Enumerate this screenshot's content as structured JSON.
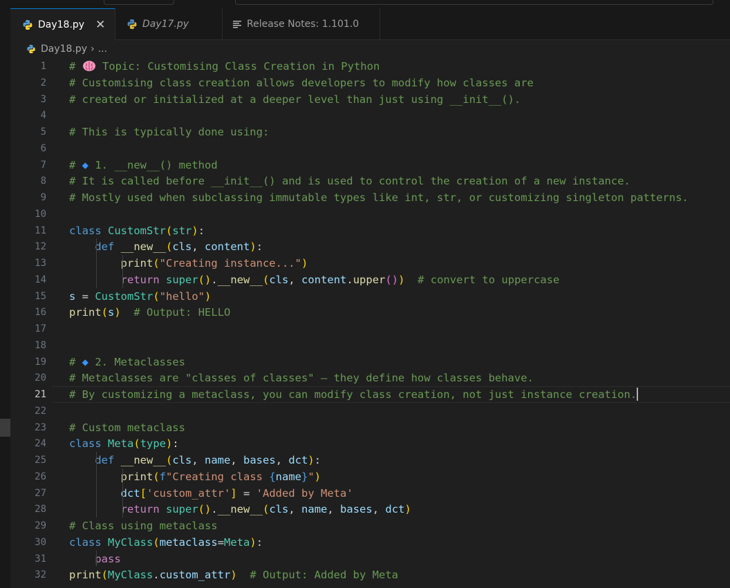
{
  "tabs": [
    {
      "label": "Day18.py",
      "active": true,
      "icon": "python-icon",
      "close": "✕"
    },
    {
      "label": "Day17.py",
      "active": false,
      "icon": "python-icon"
    },
    {
      "label": "Release Notes: 1.101.0",
      "active": false,
      "icon": "lines-icon"
    }
  ],
  "breadcrumb": {
    "file": "Day18.py",
    "separator": "›",
    "more": "..."
  },
  "editor": {
    "current_line": 21,
    "lines": [
      [
        [
          "c",
          "# "
        ],
        [
          "icon",
          "brain-emoji-icon"
        ],
        [
          "c",
          " Topic: Customising Class Creation in Python"
        ]
      ],
      [
        [
          "c",
          "# Customising class creation allows developers to modify how classes are"
        ]
      ],
      [
        [
          "c",
          "# created or initialized at a deeper level than just using __init__()."
        ]
      ],
      [],
      [
        [
          "c",
          "# This is typically done using:"
        ]
      ],
      [],
      [
        [
          "c",
          "# "
        ],
        [
          "dia",
          "◆"
        ],
        [
          "c",
          " 1. __new__() method"
        ]
      ],
      [
        [
          "c",
          "# It is called before __init__() and is used to control the creation of a new instance."
        ]
      ],
      [
        [
          "c",
          "# Mostly used when subclassing immutable types like int, str, or customizing singleton patterns."
        ]
      ],
      [],
      [
        [
          "k",
          "class"
        ],
        [
          "p",
          " "
        ],
        [
          "cl",
          "CustomStr"
        ],
        [
          "b1",
          "("
        ],
        [
          "cl",
          "str"
        ],
        [
          "b1",
          ")"
        ],
        [
          "p",
          ":"
        ]
      ],
      [
        [
          "p",
          "    "
        ],
        [
          "k",
          "def"
        ],
        [
          "p",
          " "
        ],
        [
          "fn",
          "__new__"
        ],
        [
          "b1",
          "("
        ],
        [
          "v",
          "cls"
        ],
        [
          "p",
          ", "
        ],
        [
          "v",
          "content"
        ],
        [
          "b1",
          ")"
        ],
        [
          "p",
          ":"
        ]
      ],
      [
        [
          "p",
          "        "
        ],
        [
          "fn",
          "print"
        ],
        [
          "b1",
          "("
        ],
        [
          "s",
          "\"Creating instance...\""
        ],
        [
          "b1",
          ")"
        ]
      ],
      [
        [
          "p",
          "        "
        ],
        [
          "kc",
          "return"
        ],
        [
          "p",
          " "
        ],
        [
          "cl",
          "super"
        ],
        [
          "b1",
          "("
        ],
        [
          "b1",
          ")"
        ],
        [
          "p",
          "."
        ],
        [
          "fn",
          "__new__"
        ],
        [
          "b1",
          "("
        ],
        [
          "v",
          "cls"
        ],
        [
          "p",
          ", "
        ],
        [
          "v",
          "content"
        ],
        [
          "p",
          "."
        ],
        [
          "fn",
          "upper"
        ],
        [
          "b2",
          "("
        ],
        [
          "b2",
          ")"
        ],
        [
          "b1",
          ")"
        ],
        [
          "p",
          "  "
        ],
        [
          "c",
          "# convert to uppercase"
        ]
      ],
      [
        [
          "v",
          "s"
        ],
        [
          "p",
          " = "
        ],
        [
          "cl",
          "CustomStr"
        ],
        [
          "b1",
          "("
        ],
        [
          "s",
          "\"hello\""
        ],
        [
          "b1",
          ")"
        ]
      ],
      [
        [
          "fn",
          "print"
        ],
        [
          "b1",
          "("
        ],
        [
          "v",
          "s"
        ],
        [
          "b1",
          ")"
        ],
        [
          "p",
          "  "
        ],
        [
          "c",
          "# Output: HELLO"
        ]
      ],
      [],
      [],
      [
        [
          "c",
          "# "
        ],
        [
          "dia",
          "◆"
        ],
        [
          "c",
          " 2. Metaclasses"
        ]
      ],
      [
        [
          "c",
          "# Metaclasses are \"classes of classes\" — they define how classes behave."
        ]
      ],
      [
        [
          "c",
          "# By customizing a metaclass, you can modify class creation, not just instance creation."
        ],
        [
          "cursor",
          ""
        ]
      ],
      [],
      [
        [
          "c",
          "# Custom metaclass"
        ]
      ],
      [
        [
          "k",
          "class"
        ],
        [
          "p",
          " "
        ],
        [
          "cl",
          "Meta"
        ],
        [
          "b1",
          "("
        ],
        [
          "cl",
          "type"
        ],
        [
          "b1",
          ")"
        ],
        [
          "p",
          ":"
        ]
      ],
      [
        [
          "p",
          "    "
        ],
        [
          "k",
          "def"
        ],
        [
          "p",
          " "
        ],
        [
          "fn",
          "__new__"
        ],
        [
          "b1",
          "("
        ],
        [
          "v",
          "cls"
        ],
        [
          "p",
          ", "
        ],
        [
          "v",
          "name"
        ],
        [
          "p",
          ", "
        ],
        [
          "v",
          "bases"
        ],
        [
          "p",
          ", "
        ],
        [
          "v",
          "dct"
        ],
        [
          "b1",
          ")"
        ],
        [
          "p",
          ":"
        ]
      ],
      [
        [
          "p",
          "        "
        ],
        [
          "fn",
          "print"
        ],
        [
          "b1",
          "("
        ],
        [
          "k",
          "f"
        ],
        [
          "s",
          "\"Creating class "
        ],
        [
          "k",
          "{"
        ],
        [
          "v",
          "name"
        ],
        [
          "k",
          "}"
        ],
        [
          "s",
          "\""
        ],
        [
          "b1",
          ")"
        ]
      ],
      [
        [
          "p",
          "        "
        ],
        [
          "v",
          "dct"
        ],
        [
          "b1",
          "["
        ],
        [
          "s",
          "'custom_attr'"
        ],
        [
          "b1",
          "]"
        ],
        [
          "p",
          " = "
        ],
        [
          "s",
          "'Added by Meta'"
        ]
      ],
      [
        [
          "p",
          "        "
        ],
        [
          "kc",
          "return"
        ],
        [
          "p",
          " "
        ],
        [
          "cl",
          "super"
        ],
        [
          "b1",
          "("
        ],
        [
          "b1",
          ")"
        ],
        [
          "p",
          "."
        ],
        [
          "fn",
          "__new__"
        ],
        [
          "b1",
          "("
        ],
        [
          "v",
          "cls"
        ],
        [
          "p",
          ", "
        ],
        [
          "v",
          "name"
        ],
        [
          "p",
          ", "
        ],
        [
          "v",
          "bases"
        ],
        [
          "p",
          ", "
        ],
        [
          "v",
          "dct"
        ],
        [
          "b1",
          ")"
        ]
      ],
      [
        [
          "c",
          "# Class using metaclass"
        ]
      ],
      [
        [
          "k",
          "class"
        ],
        [
          "p",
          " "
        ],
        [
          "cl",
          "MyClass"
        ],
        [
          "b1",
          "("
        ],
        [
          "v",
          "metaclass"
        ],
        [
          "p",
          "="
        ],
        [
          "cl",
          "Meta"
        ],
        [
          "b1",
          ")"
        ],
        [
          "p",
          ":"
        ]
      ],
      [
        [
          "p",
          "    "
        ],
        [
          "kc",
          "pass"
        ]
      ],
      [
        [
          "fn",
          "print"
        ],
        [
          "b1",
          "("
        ],
        [
          "cl",
          "MyClass"
        ],
        [
          "p",
          "."
        ],
        [
          "v",
          "custom_attr"
        ],
        [
          "b1",
          ")"
        ],
        [
          "p",
          "  "
        ],
        [
          "c",
          "# Output: Added by Meta"
        ]
      ]
    ]
  },
  "colors": {
    "background": "#1f1f1f",
    "comment": "#6a9955",
    "keyword": "#569cd6",
    "class": "#4ec9b0",
    "function": "#dcdcaa",
    "string": "#ce9178",
    "accent": "#0078d4"
  }
}
